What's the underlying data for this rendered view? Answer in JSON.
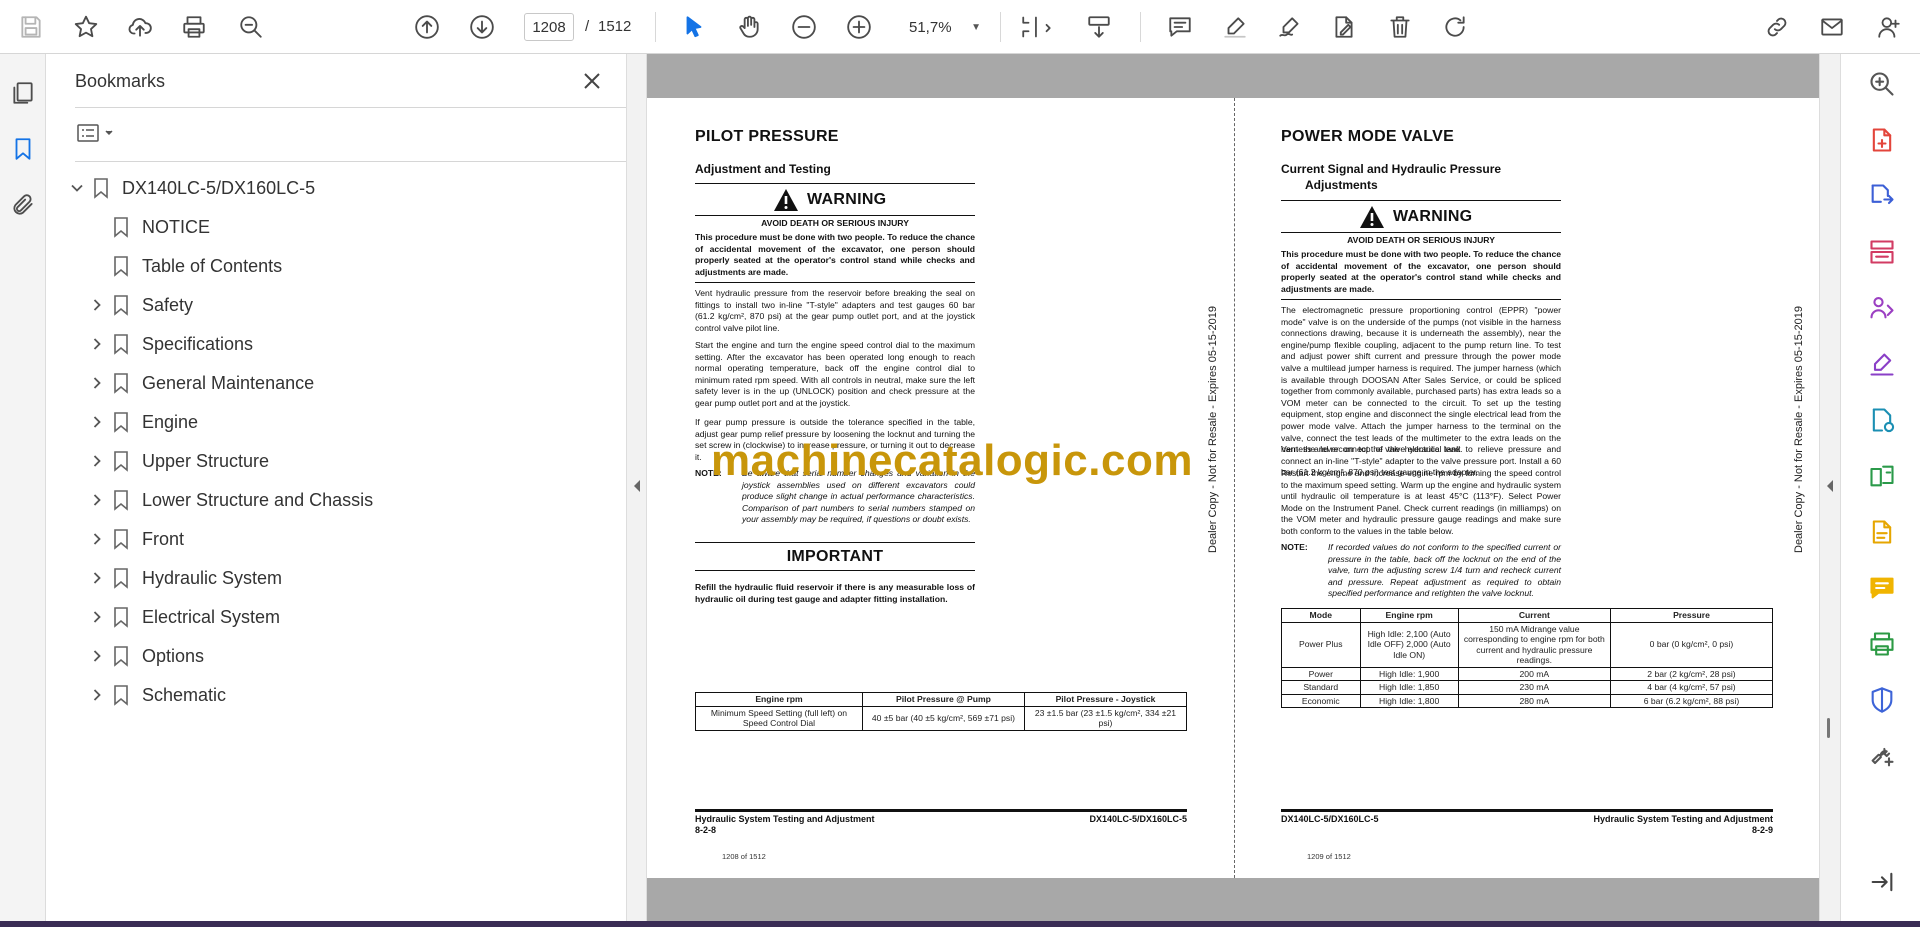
{
  "toolbar": {
    "page_current": "1208",
    "page_separator": "/",
    "page_total": "1512",
    "zoom": "51,7%"
  },
  "bookmarks": {
    "title": "Bookmarks",
    "root": "DX140LC-5/DX160LC-5",
    "items": [
      {
        "label": "NOTICE",
        "expandable": false
      },
      {
        "label": "Table of Contents",
        "expandable": false
      },
      {
        "label": "Safety",
        "expandable": true
      },
      {
        "label": "Specifications",
        "expandable": true
      },
      {
        "label": "General Maintenance",
        "expandable": true
      },
      {
        "label": "Engine",
        "expandable": true
      },
      {
        "label": "Upper Structure",
        "expandable": true
      },
      {
        "label": "Lower Structure and Chassis",
        "expandable": true
      },
      {
        "label": "Front",
        "expandable": true
      },
      {
        "label": "Hydraulic System",
        "expandable": true
      },
      {
        "label": "Electrical System",
        "expandable": true
      },
      {
        "label": "Options",
        "expandable": true
      },
      {
        "label": "Schematic",
        "expandable": true
      }
    ]
  },
  "left_page": {
    "title": "PILOT PRESSURE",
    "subtitle": "Adjustment and Testing",
    "warning_title": "WARNING",
    "warning_sub": "AVOID DEATH OR SERIOUS INJURY",
    "warning_text": "This procedure must be done with two people. To reduce the chance of accidental movement of the excavator, one person should properly seated at the operator's control stand while checks and adjustments are made.",
    "para1": "Vent hydraulic pressure from the reservoir before breaking the seal on fittings to install two in-line \"T-style\" adapters and test gauges 60 bar (61.2 kg/cm², 870 psi) at the gear pump outlet port, and at the joystick control valve pilot line.",
    "para2": "Start the engine and turn the engine speed control dial to the maximum setting. After the excavator has been operated long enough to reach normal operating temperature, back off the engine control dial to minimum rated rpm speed. With all controls in neutral, make sure the left safety lever is in the up (UNLOCK) position and check pressure at the gear pump outlet port and at the joystick.",
    "para3": "If gear pump pressure is outside the tolerance specified in the table, adjust gear pump relief pressure by loosening the locknut and turning the set screw in (clockwise) to increase pressure, or turning it out to decrease it.",
    "note_label": "NOTE:",
    "note_text": "Be aware that serial number changes and variation in the joystick assemblies used on different excavators could produce slight change in actual performance characteristics. Comparison of part numbers to serial numbers stamped on your assembly may be required, if questions or doubt exists.",
    "important_title": "IMPORTANT",
    "important_text": "Refill the hydraulic fluid reservoir if there is any measurable loss of hydraulic oil during test gauge and adapter fitting installation.",
    "table": {
      "headers": [
        "Engine rpm",
        "Pilot Pressure @ Pump",
        "Pilot Pressure - Joystick"
      ],
      "row": [
        "Minimum Speed Setting (full left) on Speed Control Dial",
        "40 ±5 bar (40 ±5 kg/cm², 569 ±71 psi)",
        "23 ±1.5 bar (23 ±1.5 kg/cm², 334 ±21 psi)"
      ]
    },
    "vertical_text": "Dealer Copy - Not for Resale - Expires 05-15-2019",
    "footer_left": "Hydraulic System Testing and Adjustment",
    "footer_left_num": "8-2-8",
    "footer_right": "DX140LC-5/DX160LC-5",
    "page_num": "1208 of 1512"
  },
  "right_page": {
    "title": "POWER MODE VALVE",
    "subtitle_1": "Current Signal and Hydraulic Pressure",
    "subtitle_2": "Adjustments",
    "warning_title": "WARNING",
    "warning_sub": "AVOID DEATH OR SERIOUS INJURY",
    "warning_text": "This procedure must be done with two people. To reduce the chance of accidental movement of the excavator, one person should properly seated at the operator's control stand while checks and adjustments are made.",
    "para1": "The electromagnetic pressure proportioning control (EPPR) \"power mode\" valve is on the underside of the pumps (not visible in the harness connections drawing, because it is underneath the assembly), near the engine/pump flexible coupling, adjacent to the pump return line. To test and adjust power shift current and pressure through the power mode valve a multilead jumper harness is required. The jumper harness (which is available through DOOSAN After Sales Service, or could be spliced together from commonly available, purchased parts) has extra leads so a VOM meter can be connected to the circuit. To set up the testing equipment, stop engine and disconnect the single electrical lead from the power mode valve. Attach the jumper harness to the terminal on the valve, connect the test leads of the multimeter to the extra leads on the harness and reconnect the valve electrical lead.",
    "para2": "Vent the lever on top of the hydraulic tank to relieve pressure and connect an in-line \"T-style\" adapter to the valve pressure port. Install a 60 bar (61.2 kg/cm², 870 psi) test gauge in the adapter.",
    "para3": "Restart the engine and increase engine rpm by turning the speed control to the maximum speed setting. Warm up the engine and hydraulic system until hydraulic oil temperature is at least 45°C (113°F). Select Power Mode on the Instrument Panel. Check current readings (in milliamps) on the VOM meter and hydraulic pressure gauge readings and make sure both conform to the values in the table below.",
    "note_label": "NOTE:",
    "note_text": "If recorded values do not conform to the specified current or pressure in the table, back off the locknut on the end of the valve, turn the adjusting screw 1/4 turn and recheck current and pressure. Repeat adjustment as required to obtain specified performance and retighten the valve locknut.",
    "table": {
      "headers": [
        "Mode",
        "Engine rpm",
        "Current",
        "Pressure"
      ],
      "rows": [
        [
          "Power Plus",
          "High Idle: 2,100 (Auto Idle OFF) 2,000 (Auto Idle ON)",
          "150 mA Midrange value corresponding to engine rpm for both current and hydraulic pressure readings.",
          "0 bar (0 kg/cm², 0 psi)"
        ],
        [
          "Power",
          "High Idle: 1,900",
          "200 mA",
          "2 bar (2 kg/cm², 28 psi)"
        ],
        [
          "Standard",
          "High Idle: 1,850",
          "230 mA",
          "4 bar (4 kg/cm², 57 psi)"
        ],
        [
          "Economic",
          "High Idle: 1,800",
          "280 mA",
          "6 bar (6.2 kg/cm², 88 psi)"
        ]
      ]
    },
    "vertical_text": "Dealer Copy - Not for Resale - Expires 05-15-2019",
    "footer_left": "DX140LC-5/DX160LC-5",
    "footer_right": "Hydraulic System Testing and Adjustment",
    "footer_right_num": "8-2-9",
    "page_num": "1209 of 1512"
  },
  "watermark": "machinecatalogic.com",
  "colors": {
    "accent": "#1473e6",
    "watermark": "#c8960a",
    "gray_band": "#a8a8a8"
  }
}
